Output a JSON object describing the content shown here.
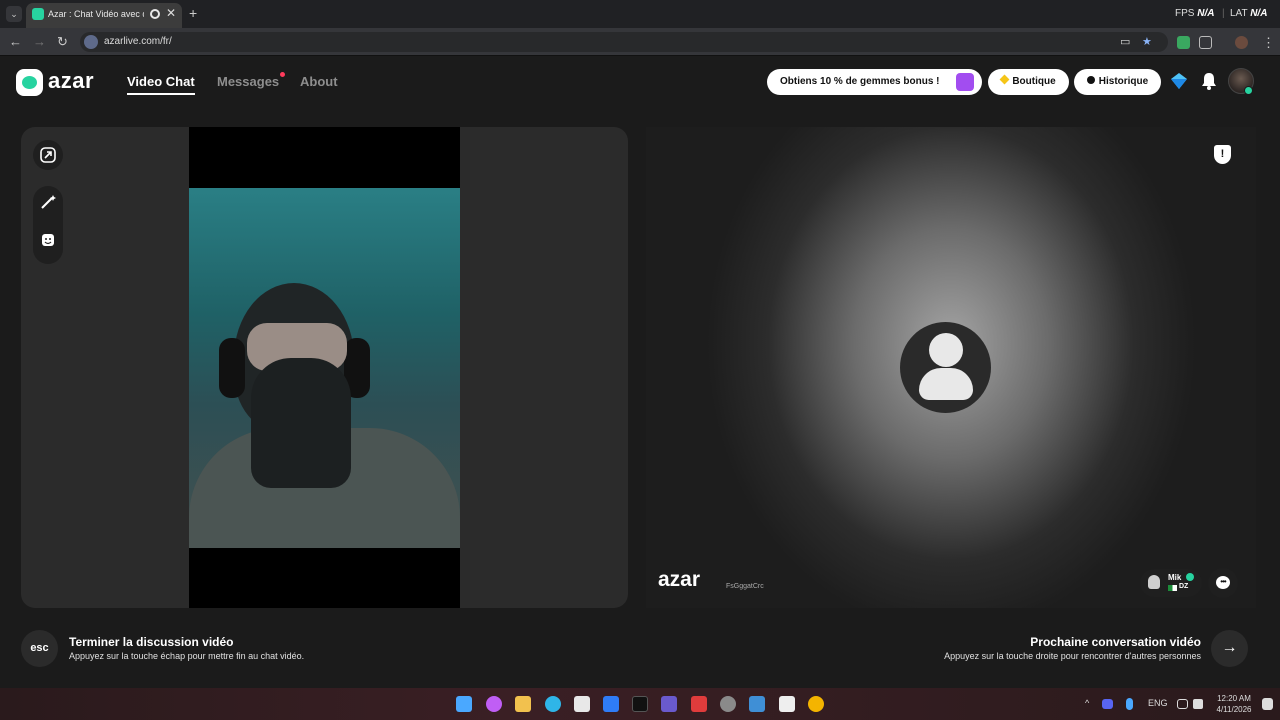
{
  "browser": {
    "tab_title": "Azar : Chat Vidéo avec de n",
    "tab_close": "✕",
    "new_tab": "+",
    "url": "azarlive.com/fr/",
    "fps_label": "FPS",
    "fps_value": "N/A",
    "lat_label": "LAT",
    "lat_value": "N/A",
    "back": "←",
    "forward": "→",
    "reload": "↻",
    "star": "★",
    "menu": "⋮"
  },
  "header": {
    "logo": "azar",
    "nav": {
      "video_chat": "Video Chat",
      "messages": "Messages",
      "about": "About"
    },
    "promo": "Obtiens 10 % de gemmes bonus !",
    "shop": "Boutique",
    "history": "Historique"
  },
  "partner": {
    "watermark": "azar",
    "watermark_id": "FsGggatCrc",
    "name": "Mik",
    "country": "DZ",
    "report_symbol": "!"
  },
  "actions": {
    "esc_key": "esc",
    "end_title": "Terminer la discussion vidéo",
    "end_desc": "Appuyez sur la touche échap pour mettre fin au chat vidéo.",
    "next_title": "Prochaine conversation vidéo",
    "next_desc": "Appuyez sur la touche droite pour rencontrer d'autres personnes",
    "next_arrow": "→"
  },
  "taskbar": {
    "language": "ENG",
    "time": "12:20 AM",
    "date": "4/11/2026",
    "chevron": "^"
  },
  "colors": {
    "brand": "#27d3a0",
    "notification": "#ff3b5c"
  }
}
